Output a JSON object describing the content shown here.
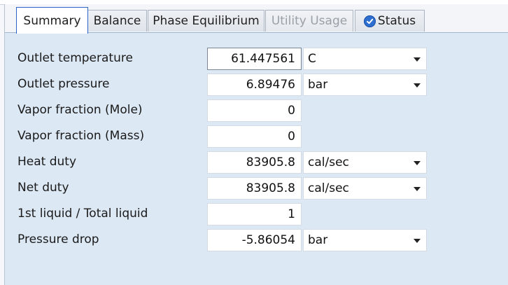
{
  "tabs": [
    {
      "label": "Summary",
      "state": "active"
    },
    {
      "label": "Balance",
      "state": "normal"
    },
    {
      "label": "Phase Equilibrium",
      "state": "normal"
    },
    {
      "label": "Utility Usage",
      "state": "disabled"
    },
    {
      "label": "Status",
      "state": "normal",
      "icon": "check-circle-icon"
    }
  ],
  "rows": [
    {
      "label": "Outlet temperature",
      "value": "61.447561",
      "unit": "C"
    },
    {
      "label": "Outlet pressure",
      "value": "6.89476",
      "unit": "bar"
    },
    {
      "label": "Vapor fraction (Mole)",
      "value": "0"
    },
    {
      "label": "Vapor fraction (Mass)",
      "value": "0"
    },
    {
      "label": "Heat duty",
      "value": "83905.8",
      "unit": "cal/sec"
    },
    {
      "label": "Net duty",
      "value": "83905.8",
      "unit": "cal/sec"
    },
    {
      "label": "1st liquid / Total liquid",
      "value": "1"
    },
    {
      "label": "Pressure drop",
      "value": "-5.86054",
      "unit": "bar"
    }
  ],
  "colors": {
    "active_tab_border": "#2b63c6",
    "panel_background": "#dde8f5",
    "status_icon": "#2d6fd1"
  }
}
